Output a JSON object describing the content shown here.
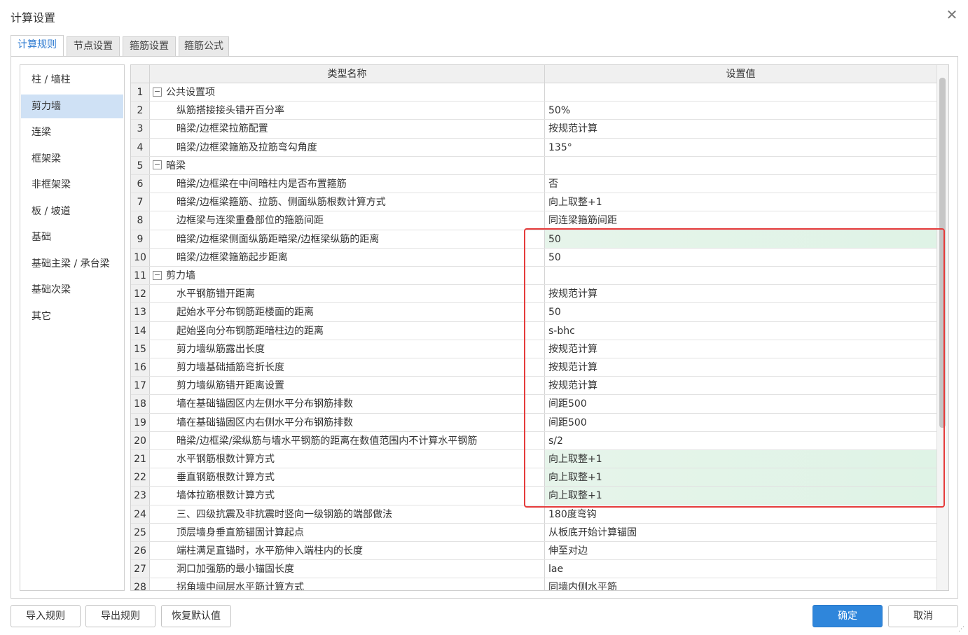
{
  "window": {
    "title": "计算设置",
    "close_glyph": "✕"
  },
  "tabs": [
    {
      "label": "计算规则",
      "active": true
    },
    {
      "label": "节点设置",
      "active": false
    },
    {
      "label": "箍筋设置",
      "active": false
    },
    {
      "label": "箍筋公式",
      "active": false
    }
  ],
  "sidebar": {
    "items": [
      {
        "label": "柱 / 墙柱"
      },
      {
        "label": "剪力墙",
        "active": true
      },
      {
        "label": "连梁"
      },
      {
        "label": "框架梁"
      },
      {
        "label": "非框架梁"
      },
      {
        "label": "板 / 坡道"
      },
      {
        "label": "基础"
      },
      {
        "label": "基础主梁 / 承台梁"
      },
      {
        "label": "基础次梁"
      },
      {
        "label": "其它"
      }
    ]
  },
  "grid": {
    "columns": {
      "name": "类型名称",
      "value": "设置值"
    },
    "rows": [
      {
        "no": "1",
        "name": "公共设置项",
        "value": "",
        "group": true
      },
      {
        "no": "2",
        "name": "纵筋搭接接头错开百分率",
        "value": "50%"
      },
      {
        "no": "3",
        "name": "暗梁/边框梁拉筋配置",
        "value": "按规范计算"
      },
      {
        "no": "4",
        "name": "暗梁/边框梁箍筋及拉筋弯勾角度",
        "value": "135°"
      },
      {
        "no": "5",
        "name": "暗梁",
        "value": "",
        "group": true
      },
      {
        "no": "6",
        "name": "暗梁/边框梁在中间暗柱内是否布置箍筋",
        "value": "否"
      },
      {
        "no": "7",
        "name": "暗梁/边框梁箍筋、拉筋、侧面纵筋根数计算方式",
        "value": "向上取整+1"
      },
      {
        "no": "8",
        "name": "边框梁与连梁重叠部位的箍筋间距",
        "value": "同连梁箍筋间距"
      },
      {
        "no": "9",
        "name": "暗梁/边框梁侧面纵筋距暗梁/边框梁纵筋的距离",
        "value": "50",
        "highlight": true
      },
      {
        "no": "10",
        "name": "暗梁/边框梁箍筋起步距离",
        "value": "50"
      },
      {
        "no": "11",
        "name": "剪力墙",
        "value": "",
        "group": true
      },
      {
        "no": "12",
        "name": "水平钢筋错开距离",
        "value": "按规范计算"
      },
      {
        "no": "13",
        "name": "起始水平分布钢筋距楼面的距离",
        "value": "50"
      },
      {
        "no": "14",
        "name": "起始竖向分布钢筋距暗柱边的距离",
        "value": "s-bhc"
      },
      {
        "no": "15",
        "name": "剪力墙纵筋露出长度",
        "value": "按规范计算"
      },
      {
        "no": "16",
        "name": "剪力墙基础插筋弯折长度",
        "value": "按规范计算"
      },
      {
        "no": "17",
        "name": "剪力墙纵筋错开距离设置",
        "value": "按规范计算"
      },
      {
        "no": "18",
        "name": "墙在基础锚固区内左侧水平分布钢筋排数",
        "value": "间距500"
      },
      {
        "no": "19",
        "name": "墙在基础锚固区内右侧水平分布钢筋排数",
        "value": "间距500"
      },
      {
        "no": "20",
        "name": "暗梁/边框梁/梁纵筋与墙水平钢筋的距离在数值范围内不计算水平钢筋",
        "value": "s/2"
      },
      {
        "no": "21",
        "name": "水平钢筋根数计算方式",
        "value": "向上取整+1",
        "highlight": true
      },
      {
        "no": "22",
        "name": "垂直钢筋根数计算方式",
        "value": "向上取整+1",
        "highlight": true
      },
      {
        "no": "23",
        "name": "墙体拉筋根数计算方式",
        "value": "向上取整+1",
        "highlight": true
      },
      {
        "no": "24",
        "name": "三、四级抗震及非抗震时竖向一级钢筋的端部做法",
        "value": "180度弯钩"
      },
      {
        "no": "25",
        "name": "顶层墙身垂直筋锚固计算起点",
        "value": "从板底开始计算锚固"
      },
      {
        "no": "26",
        "name": "端柱满足直锚时，水平筋伸入端柱内的长度",
        "value": "伸至对边"
      },
      {
        "no": "27",
        "name": "洞口加强筋的最小锚固长度",
        "value": "lae"
      },
      {
        "no": "28",
        "name": "拐角墙中间层水平筋计算方式",
        "value": "同墙内侧水平筋"
      }
    ]
  },
  "buttons": {
    "import": "导入规则",
    "export": "导出规则",
    "reset": "恢复默认值",
    "ok": "确定",
    "cancel": "取消"
  },
  "colors": {
    "accent": "#2f86db",
    "highlight_box": "#e53b3b",
    "row_highlight": "#e6f4ea"
  }
}
